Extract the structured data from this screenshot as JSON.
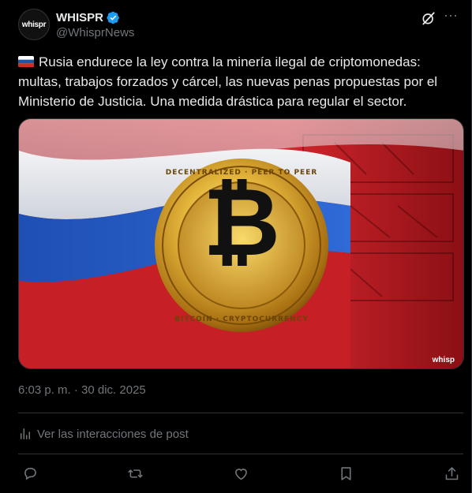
{
  "author": {
    "display_name": "WHISPR",
    "handle": "@WhisprNews",
    "avatar_text": "whispr",
    "verified": true
  },
  "tweet": {
    "text": "Rusia endurece la ley contra la minería ilegal de criptomonedas: multas, trabajos forzados y cárcel, las nuevas penas propuestas por el Ministerio de Justicia. Una medida drástica para regular el sector.",
    "flag": "russia-flag-icon"
  },
  "media": {
    "watermark": "whisp",
    "coin_text_top": "DECENTRALIZED · PEER TO PEER",
    "coin_text_bottom": "BITCOIN · CRYPTOCURRENCY",
    "coin_symbol": "₿"
  },
  "timestamp": "6:03 p. m. · 30 dic. 2025",
  "analytics_label": "Ver las interacciones de post",
  "colors": {
    "background": "#000000",
    "text": "#e7e9ea",
    "secondary": "#71767b",
    "divider": "#2f3336",
    "verified": "#1d9bf0"
  },
  "icons": {
    "grok": "grok-icon",
    "more": "more-icon",
    "reply": "reply-icon",
    "repost": "repost-icon",
    "like": "like-icon",
    "bookmark": "bookmark-icon",
    "share": "share-icon",
    "analytics": "analytics-icon"
  }
}
